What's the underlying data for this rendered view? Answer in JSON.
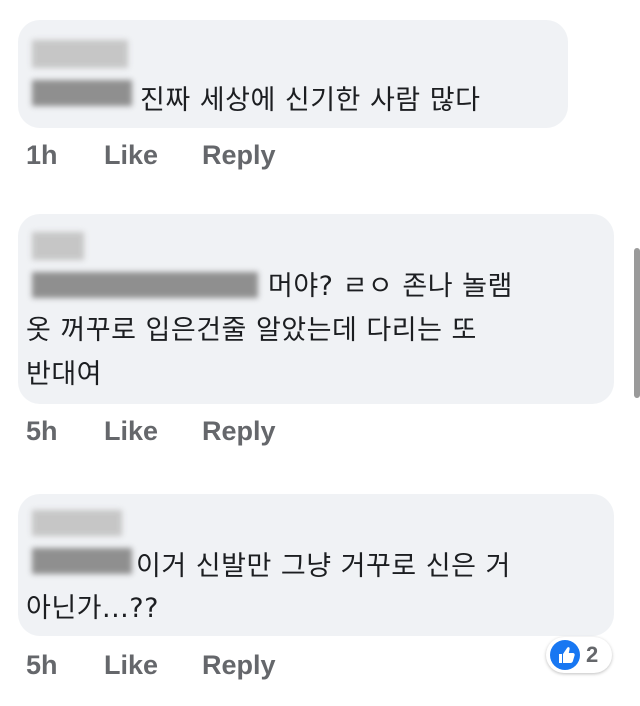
{
  "comments": [
    {
      "lines": [
        "진짜 세상에 신기한 사람 많다"
      ],
      "time": "1h",
      "like_label": "Like",
      "reply_label": "Reply"
    },
    {
      "lines": [
        "머야? ㄹㅇ 존나 놀램",
        "옷 꺼꾸로 입은건줄 알았는데 다리는 또",
        "반대여"
      ],
      "time": "5h",
      "like_label": "Like",
      "reply_label": "Reply"
    },
    {
      "lines": [
        "이거 신발만 그냥 거꾸로 신은 거",
        "아닌가...??"
      ],
      "time": "5h",
      "like_label": "Like",
      "reply_label": "Reply",
      "reaction_count": "2"
    }
  ],
  "colors": {
    "bubble": "#f0f2f5",
    "text": "#1c1e21",
    "meta": "#65676b",
    "like_blue": "#1877f2"
  },
  "icons": {
    "reaction": "thumbs-up-icon"
  }
}
